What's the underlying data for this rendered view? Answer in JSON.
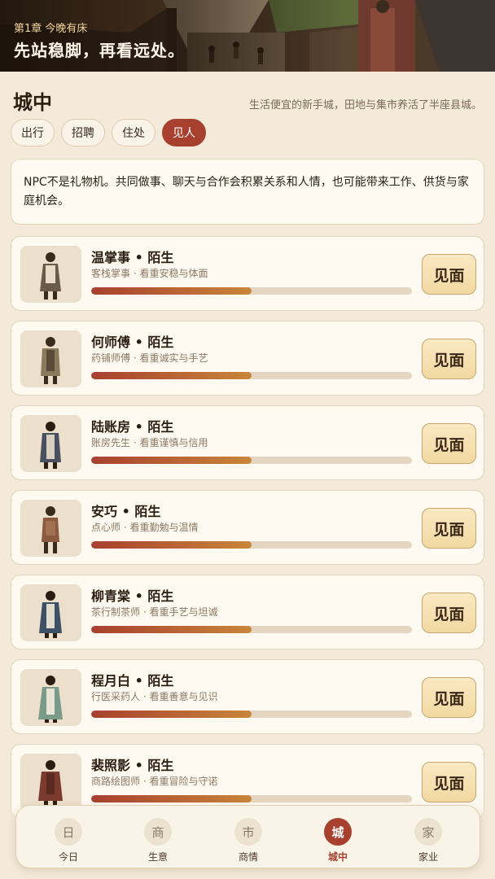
{
  "banner": {
    "chapter": "第1章 今晚有床",
    "headline": "先站稳脚，再看远处。"
  },
  "header": {
    "title": "城中",
    "subtitle": "生活便宜的新手城，田地与集市养活了半座县城。"
  },
  "tabs": [
    {
      "label": "出行",
      "active": false
    },
    {
      "label": "招聘",
      "active": false
    },
    {
      "label": "住处",
      "active": false
    },
    {
      "label": "见人",
      "active": true
    }
  ],
  "notice": "NPC不是礼物机。共同做事、聊天与合作会积累关系和人情，也可能带来工作、供货与家庭机会。",
  "npcs": [
    {
      "name": "温掌事 • 陌生",
      "desc": "客栈掌事 · 看重安稳与体面",
      "relation": 0.5,
      "button": "见面"
    },
    {
      "name": "何师傅 • 陌生",
      "desc": "药铺师傅 · 看重诚实与手艺",
      "relation": 0.5,
      "button": "见面"
    },
    {
      "name": "陆账房 • 陌生",
      "desc": "账房先生 · 看重谨慎与信用",
      "relation": 0.5,
      "button": "见面"
    },
    {
      "name": "安巧 • 陌生",
      "desc": "点心师 · 看重勤勉与温情",
      "relation": 0.5,
      "button": "见面"
    },
    {
      "name": "柳青棠 • 陌生",
      "desc": "茶行制茶师 · 看重手艺与坦诚",
      "relation": 0.5,
      "button": "见面"
    },
    {
      "name": "程月白 • 陌生",
      "desc": "行医采药人 · 看重善意与见识",
      "relation": 0.5,
      "button": "见面"
    },
    {
      "name": "裴照影 • 陌生",
      "desc": "商路绘图师 · 看重冒险与守诺",
      "relation": 0.5,
      "button": "见面"
    }
  ],
  "nav": [
    {
      "icon": "日",
      "label": "今日",
      "active": false
    },
    {
      "icon": "商",
      "label": "生意",
      "active": false
    },
    {
      "icon": "市",
      "label": "商情",
      "active": false
    },
    {
      "icon": "城",
      "label": "城中",
      "active": true
    },
    {
      "icon": "家",
      "label": "家业",
      "active": false
    }
  ],
  "colors": {
    "accent": "#a8402f",
    "background": "#f3ead9",
    "card": "#fffaf1",
    "button": "#f6dfae"
  }
}
